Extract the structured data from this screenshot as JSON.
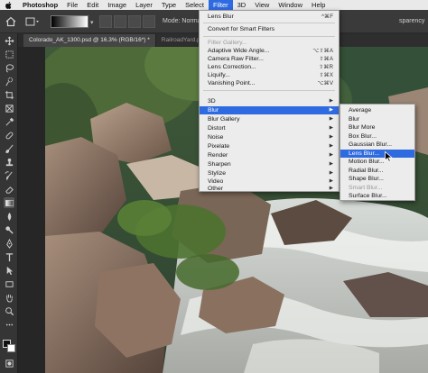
{
  "menubar": {
    "app": "Photoshop",
    "items": [
      "File",
      "Edit",
      "Image",
      "Layer",
      "Type",
      "Select",
      "Filter",
      "3D",
      "View",
      "Window",
      "Help"
    ],
    "active": "Filter"
  },
  "options_bar": {
    "mode_label": "Mode:",
    "mode_value": "Normal",
    "transparency": "sparency"
  },
  "tabs": [
    {
      "label": "Colorado_AK_1300.psd @ 16.3% (RGB/16*) *",
      "active": true
    },
    {
      "label": "RailroadYard.psd",
      "active": false
    }
  ],
  "filter_menu": {
    "items": [
      {
        "label": "Lens Blur",
        "shortcut": "^⌘F",
        "disabled": false
      },
      {
        "label": "Convert for Smart Filters",
        "disabled": false
      },
      {
        "label": "Filter Gallery...",
        "disabled": true
      },
      {
        "label": "Adaptive Wide Angle...",
        "shortcut": "⌥⇧⌘A",
        "disabled": false
      },
      {
        "label": "Camera Raw Filter...",
        "shortcut": "⇧⌘A",
        "disabled": false
      },
      {
        "label": "Lens Correction...",
        "shortcut": "⇧⌘R",
        "disabled": false
      },
      {
        "label": "Liquify...",
        "shortcut": "⇧⌘X",
        "disabled": false
      },
      {
        "label": "Vanishing Point...",
        "shortcut": "⌥⌘V",
        "disabled": false
      },
      {
        "label": "3D",
        "submenu": true,
        "disabled": false
      },
      {
        "label": "Blur",
        "submenu": true,
        "highlighted": true
      },
      {
        "label": "Blur Gallery",
        "submenu": true
      },
      {
        "label": "Distort",
        "submenu": true
      },
      {
        "label": "Noise",
        "submenu": true
      },
      {
        "label": "Pixelate",
        "submenu": true
      },
      {
        "label": "Render",
        "submenu": true
      },
      {
        "label": "Sharpen",
        "submenu": true
      },
      {
        "label": "Stylize",
        "submenu": true
      },
      {
        "label": "Video",
        "submenu": true
      },
      {
        "label": "Other",
        "submenu": true
      }
    ]
  },
  "blur_menu": {
    "items": [
      {
        "label": "Average"
      },
      {
        "label": "Blur"
      },
      {
        "label": "Blur More"
      },
      {
        "label": "Box Blur..."
      },
      {
        "label": "Gaussian Blur..."
      },
      {
        "label": "Lens Blur...",
        "highlighted": true
      },
      {
        "label": "Motion Blur..."
      },
      {
        "label": "Radial Blur..."
      },
      {
        "label": "Shape Blur..."
      },
      {
        "label": "Smart Blur...",
        "disabled": true
      },
      {
        "label": "Surface Blur..."
      }
    ]
  },
  "toolbar": {
    "tools": [
      "move-tool",
      "marquee-tool",
      "lasso-tool",
      "quick-select-tool",
      "crop-tool",
      "frame-tool",
      "eyedropper-tool",
      "healing-tool",
      "brush-tool",
      "clone-stamp-tool",
      "history-brush-tool",
      "eraser-tool",
      "gradient-tool",
      "blur-tool",
      "dodge-tool",
      "pen-tool",
      "type-tool",
      "path-select-tool",
      "rectangle-tool",
      "hand-tool",
      "zoom-tool",
      "more-tools"
    ],
    "selected": "gradient-tool"
  },
  "colors": {
    "menu_highlight": "#2f6be0",
    "menu_bg": "#ececec",
    "ps_panel": "#353535"
  }
}
